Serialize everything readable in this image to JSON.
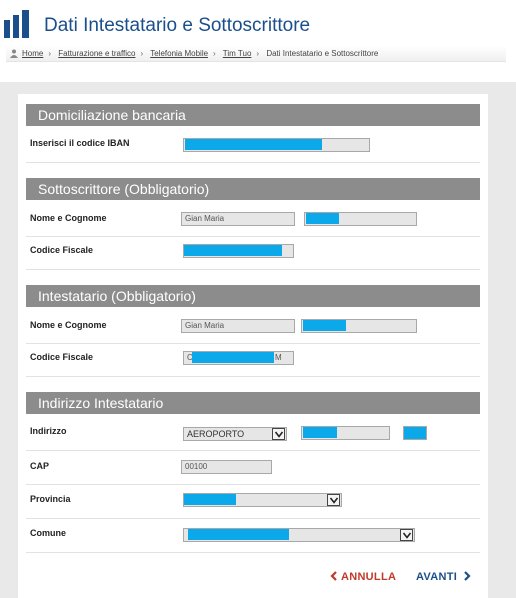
{
  "header": {
    "title": "Dati Intestatario e Sottoscrittore"
  },
  "breadcrumb": {
    "items": [
      "Home",
      "Fatturazione e traffico",
      "Telefonia Mobile",
      "Tim Tuo",
      "Dati Intestatario e Sottoscrittore"
    ]
  },
  "sections": {
    "domiciliazione": {
      "title": "Domiciliazione bancaria",
      "iban_label": "Inserisci il codice IBAN"
    },
    "sottoscrittore": {
      "title": "Sottoscrittore (Obbligatorio)",
      "name_label": "Nome e Cognome",
      "first_name_value": "Gian Maria",
      "cf_label": "Codice Fiscale"
    },
    "intestatario": {
      "title": "Intestatario (Obbligatorio)",
      "name_label": "Nome e Cognome",
      "first_name_value": "Gian Maria",
      "cf_label": "Codice Fiscale",
      "cf_prefix": "C",
      "cf_suffix": "M"
    },
    "indirizzo": {
      "title": "Indirizzo Intestatario",
      "address_label": "Indirizzo",
      "street_type_value": "AEROPORTO",
      "cap_label": "CAP",
      "cap_value": "00100",
      "provincia_label": "Provincia",
      "comune_label": "Comune"
    }
  },
  "actions": {
    "cancel_label": "ANNULLA",
    "next_label": "AVANTI"
  },
  "colors": {
    "brand": "#1a4f8b",
    "section_bar": "#8c8c8c",
    "cancel": "#c0392b",
    "redaction": "#0ba9ea"
  }
}
